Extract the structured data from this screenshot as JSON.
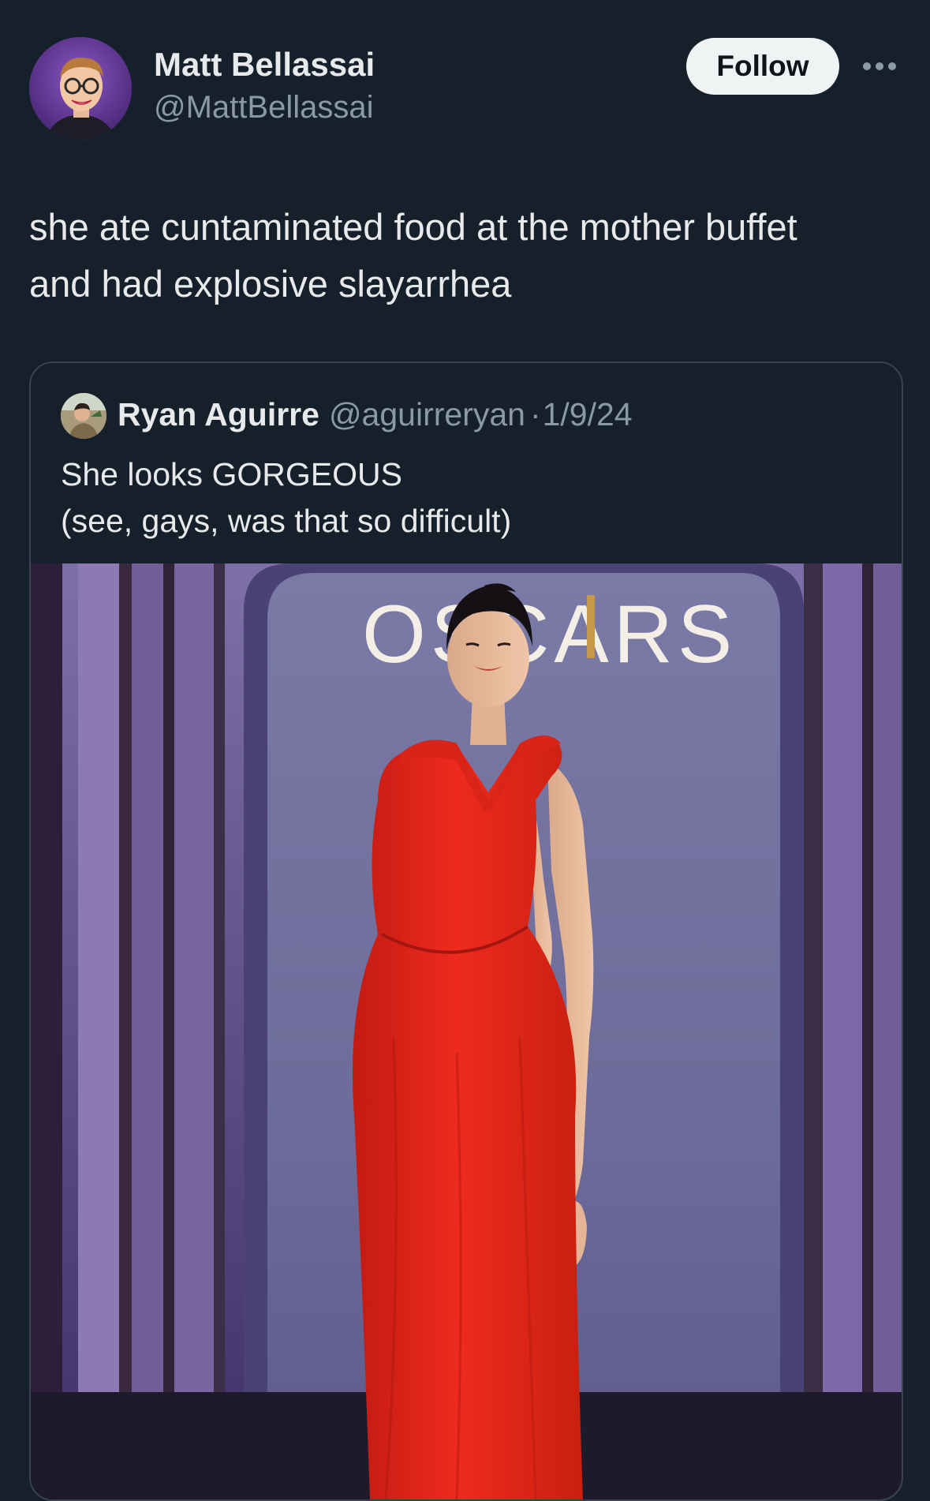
{
  "author": {
    "name": "Matt Bellassai",
    "handle": "@MattBellassai",
    "follow_label": "Follow"
  },
  "tweet": {
    "lines": [
      "she ate cuntaminated food at the mother buffet",
      "and had explosive slayarrhea"
    ]
  },
  "quoted": {
    "name": "Ryan Aguirre",
    "handle": "@aguirreryan",
    "separator": "·",
    "date": "1/9/24",
    "lines": [
      "She looks GORGEOUS",
      "(see, gays, was that so difficult)"
    ],
    "photo": {
      "backdrop_text": "OSCARS",
      "dress_color": "#e8261c",
      "backdrop_color": "#6e6d9a"
    }
  },
  "icons": {
    "more": "more-dots-icon"
  },
  "colors": {
    "background": "#15202b",
    "text": "#e7e9ea",
    "muted": "#8b98a5",
    "follow_bg": "#eff3f4",
    "border": "#38444d"
  }
}
